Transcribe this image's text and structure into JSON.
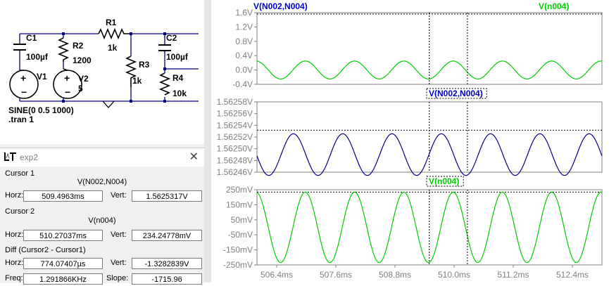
{
  "schematic": {
    "components": {
      "c1": "C1",
      "c1_value": "100µf",
      "r1": "R1",
      "r1_value": "1k",
      "r2": "R2",
      "r2_value": "1200",
      "v1": "V1",
      "v2": "V2",
      "v2_value": "5",
      "r3": "R3",
      "r3_value": "1k",
      "c2": "C2",
      "c2_value": "100µf",
      "r4": "R4",
      "r4_value": "10k"
    },
    "directive_sine": "SINE(0 0.5 1000)",
    "directive_tran": ".tran 1"
  },
  "cursor_panel": {
    "title": "exp2",
    "close_glyph": "✕",
    "cursor1": {
      "heading": "Cursor 1",
      "trace": "V(N002,N004)",
      "horz_label": "Horz:",
      "horz": "509.4963ms",
      "vert_label": "Vert:",
      "vert": "1.5625317V"
    },
    "cursor2": {
      "heading": "Cursor 2",
      "trace": "V(n004)",
      "horz_label": "Horz:",
      "horz": "510.27037ms",
      "vert_label": "Vert:",
      "vert": "234.24778mV"
    },
    "diff": {
      "heading": "Diff (Cursor2 - Cursor1)",
      "horz_label": "Horz:",
      "horz": "774.07407µs",
      "vert_label": "Vert:",
      "vert": "-1.3282839V",
      "freq_label": "Freq:",
      "freq": "1.291866KHz",
      "slope_label": "Slope:",
      "slope": "-1715.96"
    }
  },
  "colors": {
    "trace_diff": "#00008b",
    "trace_n004": "#00cc00",
    "title_blue": "#0000cc",
    "title_green": "#00cc00",
    "axis_text": "#808080",
    "schematic_wire": "#000080"
  },
  "chart_data": [
    {
      "type": "line",
      "header_labels": [
        "V(N002,N004)",
        "V(n004)"
      ],
      "ytick_labels": [
        "1.6V",
        "1.2V",
        "0.8V",
        "0.4V",
        "0.0V",
        "-0.4V"
      ],
      "ylim": [
        -0.4,
        1.6
      ],
      "xlim": [
        506.0,
        513.0
      ],
      "series": [
        {
          "name": "V(n004)",
          "amplitude": 0.25,
          "offset": 0.0,
          "frequency_khz": 1.0,
          "phase_cycles": 0.27
        }
      ],
      "grid": false,
      "cursors_ms": [
        509.4963,
        510.27037
      ],
      "horizontal_dashed_y": 1.5625317
    },
    {
      "type": "line",
      "header_labels": [
        "V(N002,N004)"
      ],
      "ytick_labels": [
        "1.56258V",
        "1.56256V",
        "1.56254V",
        "1.56252V",
        "1.56250V",
        "1.56248V",
        "1.56246V"
      ],
      "ylim": [
        1.56246,
        1.56258
      ],
      "xlim": [
        506.0,
        513.0
      ],
      "series": [
        {
          "name": "V(N002,N004)",
          "amplitude": 3.56e-05,
          "offset": 1.56249,
          "frequency_khz": 1.0,
          "phase_cycles": 0.51
        }
      ],
      "grid": false,
      "cursors_ms": [
        509.4963,
        510.27037
      ],
      "horizontal_dashed_y": 1.5625317
    },
    {
      "type": "line",
      "header_labels": [
        "V(n004)"
      ],
      "ytick_labels": [
        "250mV",
        "150mV",
        "50mV",
        "-50mV",
        "-150mV",
        "-250mV"
      ],
      "ylim": [
        -250,
        250
      ],
      "xlim": [
        506.0,
        513.0
      ],
      "series": [
        {
          "name": "V(n004)",
          "amplitude": 234.25,
          "offset": 0.0,
          "frequency_khz": 1.0,
          "phase_cycles": 0.27
        }
      ],
      "grid": false,
      "cursors_ms": [
        509.4963,
        510.27037
      ],
      "horizontal_dashed_y": 234.24778
    }
  ],
  "x_axis": {
    "tick_labels": [
      "506.4ms",
      "507.6ms",
      "508.8ms",
      "510.0ms",
      "511.2ms",
      "512.4ms"
    ],
    "tick_values_ms": [
      506.4,
      507.6,
      508.8,
      510.0,
      511.2,
      512.4
    ]
  }
}
